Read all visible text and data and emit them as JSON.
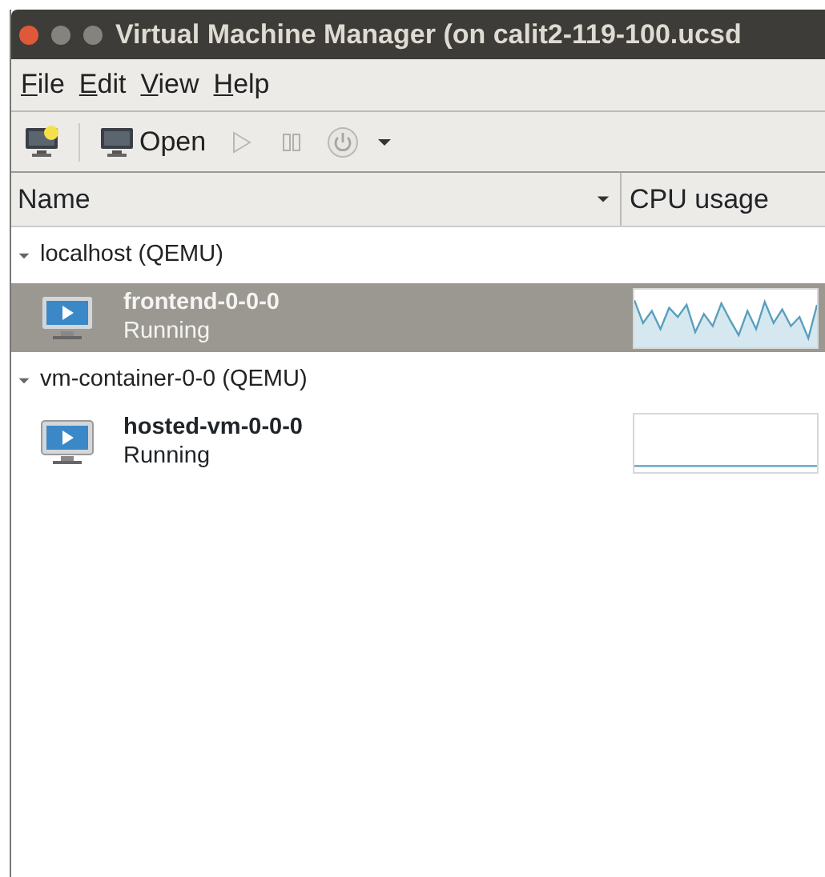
{
  "window": {
    "title": "Virtual Machine Manager (on calit2-119-100.ucsd"
  },
  "menu": [
    {
      "label": "File"
    },
    {
      "label": "Edit"
    },
    {
      "label": "View"
    },
    {
      "label": "Help"
    }
  ],
  "toolbar": [
    {
      "kind": "new",
      "disabled": false
    },
    {
      "kind": "open",
      "label": "Open",
      "disabled": false
    },
    {
      "kind": "run",
      "disabled": true
    },
    {
      "kind": "pause",
      "disabled": true
    },
    {
      "kind": "power",
      "disabled": true
    }
  ],
  "table": {
    "columns": [
      "Name",
      "CPU usage"
    ],
    "groups": [
      {
        "label": "localhost (QEMU)",
        "expanded": true,
        "children": [
          {
            "name": "frontend-0-0-0",
            "status": "Running",
            "selected": true,
            "kind": "busy"
          }
        ]
      },
      {
        "label": "vm-container-0-0 (QEMU)",
        "expanded": true,
        "children": [
          {
            "name": "hosted-vm-0-0-0",
            "status": "Running",
            "selected": false,
            "kind": "idle"
          }
        ]
      }
    ]
  }
}
